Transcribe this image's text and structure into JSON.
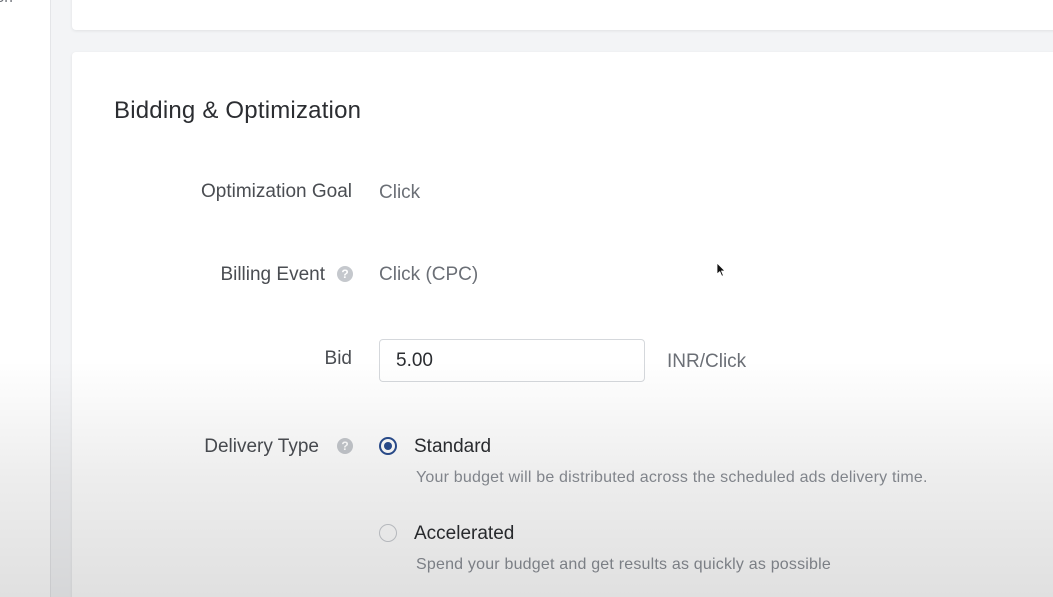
{
  "sidebar": {
    "fragment_text": "on"
  },
  "section": {
    "title": "Bidding & Optimization"
  },
  "fields": {
    "optimization_goal": {
      "label": "Optimization Goal",
      "value": "Click"
    },
    "billing_event": {
      "label": "Billing Event",
      "value": "Click (CPC)",
      "help_icon": "question-circle-icon"
    },
    "bid": {
      "label": "Bid",
      "value": "5.00",
      "unit": "INR/Click"
    },
    "delivery_type": {
      "label": "Delivery Type",
      "help_icon": "question-circle-icon",
      "options": [
        {
          "label": "Standard",
          "description": "Your budget will be distributed across the scheduled ads delivery time.",
          "selected": true
        },
        {
          "label": "Accelerated",
          "description": "Spend your budget and get results as quickly as possible",
          "selected": false
        }
      ]
    }
  },
  "colors": {
    "accent": "#2a4d8f",
    "background": "#f3f4f6",
    "card": "#ffffff"
  }
}
